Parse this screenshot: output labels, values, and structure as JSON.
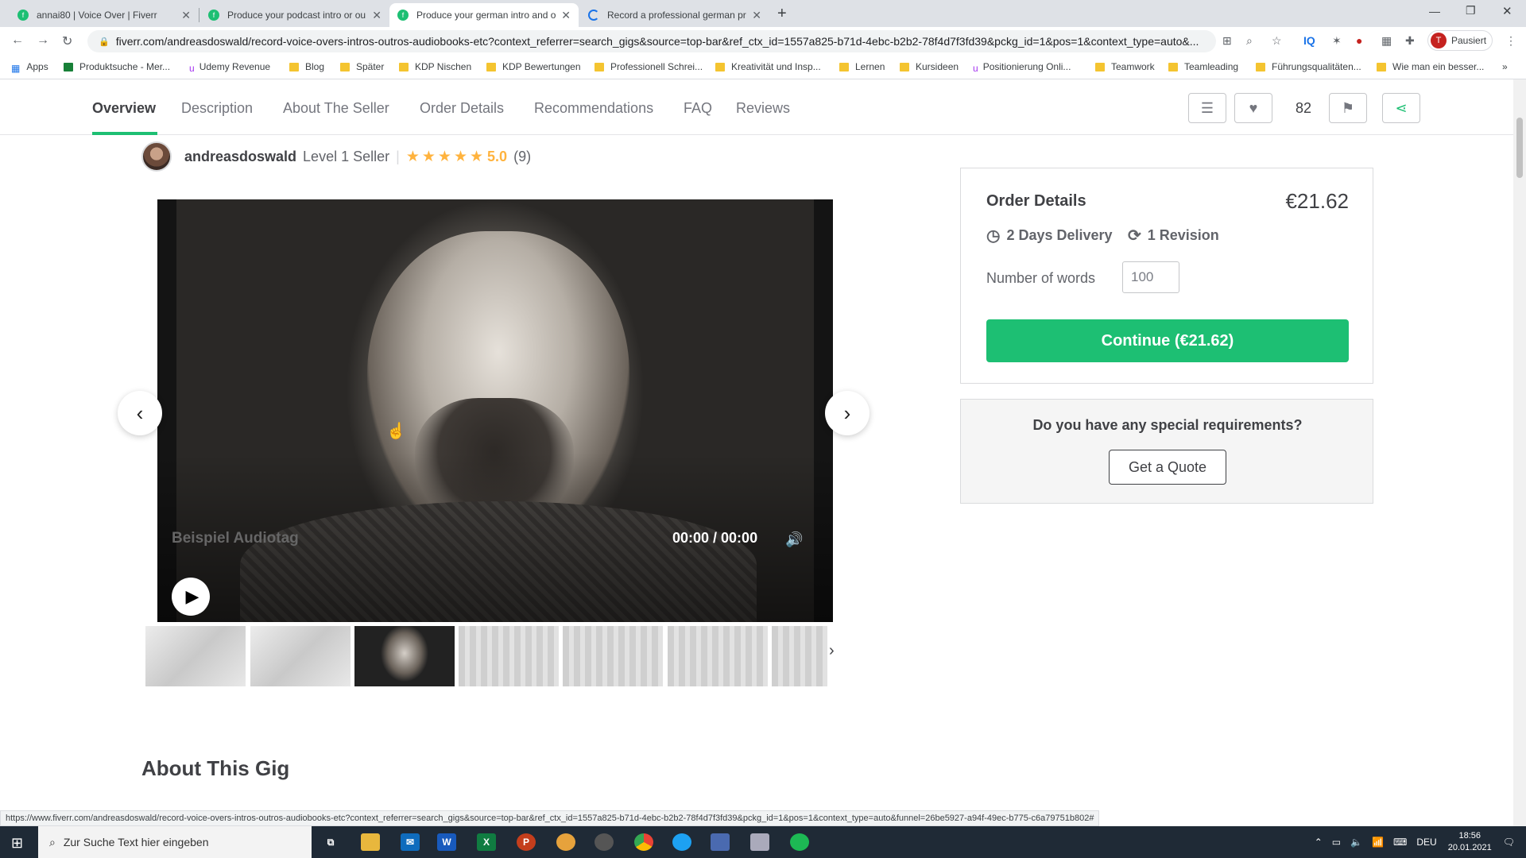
{
  "browser": {
    "tabs": [
      {
        "title": "annai80 | Voice Over | Fiverr"
      },
      {
        "title": "Produce your podcast intro or ou"
      },
      {
        "title": "Produce your german intro and o"
      },
      {
        "title": "Record a professional german pr"
      }
    ],
    "url": "fiverr.com/andreasdoswald/record-voice-overs-intros-outros-audiobooks-etc?context_referrer=search_gigs&source=top-bar&ref_ctx_id=1557a825-b71d-4ebc-b2b2-78f4d7f3fd39&pckg_id=1&pos=1&context_type=auto&...",
    "profile_label": "Pausiert",
    "profile_initial": "T",
    "bookmarks": [
      "Apps",
      "Produktsuche - Mer...",
      "Udemy Revenue",
      "Blog",
      "Später",
      "KDP Nischen",
      "KDP Bewertungen",
      "Professionell Schrei...",
      "Kreativität und Insp...",
      "Lernen",
      "Kursideen",
      "Positionierung Onli...",
      "Teamwork",
      "Teamleading",
      "Führungsqualitäten...",
      "Wie man ein besser..."
    ],
    "status_url": "https://www.fiverr.com/andreasdoswald/record-voice-overs-intros-outros-audiobooks-etc?context_referrer=search_gigs&source=top-bar&ref_ctx_id=1557a825-b71d-4ebc-b2b2-78f4d7f3fd39&pckg_id=1&pos=1&context_type=auto&funnel=26be5927-a94f-49ec-b775-c6a79751b802#"
  },
  "subnav": {
    "items": [
      "Overview",
      "Description",
      "About The Seller",
      "Order Details",
      "Recommendations",
      "FAQ",
      "Reviews"
    ],
    "likes": "82"
  },
  "seller": {
    "name": "andreasdoswald",
    "level": "Level 1 Seller",
    "divider": "|",
    "rating": "5.0",
    "reviews": "(9)",
    "stars": 5
  },
  "player": {
    "tag": "Beispiel Audiotag",
    "time": "00:00 / 00:00"
  },
  "about_title": "About This Gig",
  "order": {
    "title": "Order Details",
    "price": "€21.62",
    "delivery": "2 Days Delivery",
    "revision": "1 Revision",
    "words_label": "Number of words",
    "words_value": "100",
    "continue": "Continue (€21.62)"
  },
  "quote": {
    "question": "Do you have any special requirements?",
    "button": "Get a Quote"
  },
  "taskbar": {
    "search_placeholder": "Zur Suche Text hier eingeben",
    "lang": "DEU",
    "time": "18:56",
    "date": "20.01.2021"
  }
}
